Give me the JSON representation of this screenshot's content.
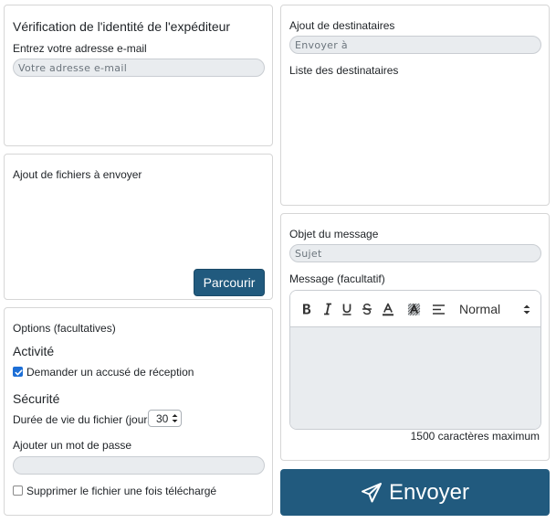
{
  "sender": {
    "title": "Vérification de l'identité de l'expéditeur",
    "email_label": "Entrez votre adresse e-mail",
    "email_placeholder": "Votre adresse e-mail",
    "email_value": ""
  },
  "files": {
    "title": "Ajout de fichiers à envoyer",
    "browse_label": "Parcourir"
  },
  "options": {
    "title": "Options (facultatives)",
    "activity_heading": "Activité",
    "receipt_label": "Demander un accusé de réception",
    "receipt_checked": true,
    "security_heading": "Sécurité",
    "lifetime_label": "Durée de vie du fichier (jours)",
    "lifetime_value": "30",
    "password_label": "Ajouter un mot de passe",
    "password_value": "",
    "delete_label": "Supprimer le fichier une fois téléchargé",
    "delete_checked": false
  },
  "recipients": {
    "title": "Ajout de destinataires",
    "to_placeholder": "Envoyer à",
    "list_label": "Liste des destinataires"
  },
  "message": {
    "subject_label": "Objet du message",
    "subject_placeholder": "Sujet",
    "body_label": "Message (facultatif)",
    "format_value": "Normal",
    "toolbar_icons": [
      "bold-icon",
      "italic-icon",
      "underline-icon",
      "strikethrough-icon",
      "font-color-icon",
      "background-color-icon",
      "align-icon"
    ],
    "char_limit": "1500 caractères maximum"
  },
  "send": {
    "label": "Envoyer",
    "icon": "paper-plane-icon"
  },
  "colors": {
    "primary": "#215a7e",
    "input_bg": "#e9ecef",
    "checkbox": "#1d6fd6"
  }
}
